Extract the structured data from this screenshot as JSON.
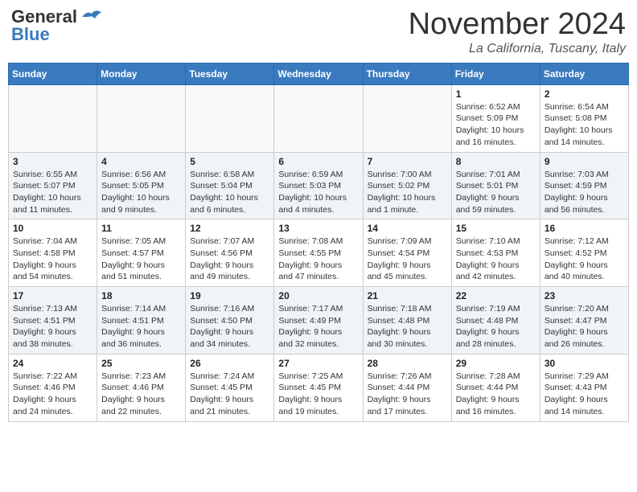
{
  "header": {
    "logo_general": "General",
    "logo_blue": "Blue",
    "month_year": "November 2024",
    "location": "La California, Tuscany, Italy"
  },
  "weekdays": [
    "Sunday",
    "Monday",
    "Tuesday",
    "Wednesday",
    "Thursday",
    "Friday",
    "Saturday"
  ],
  "weeks": [
    {
      "days": [
        {
          "num": "",
          "info": ""
        },
        {
          "num": "",
          "info": ""
        },
        {
          "num": "",
          "info": ""
        },
        {
          "num": "",
          "info": ""
        },
        {
          "num": "",
          "info": ""
        },
        {
          "num": "1",
          "info": "Sunrise: 6:52 AM\nSunset: 5:09 PM\nDaylight: 10 hours\nand 16 minutes."
        },
        {
          "num": "2",
          "info": "Sunrise: 6:54 AM\nSunset: 5:08 PM\nDaylight: 10 hours\nand 14 minutes."
        }
      ]
    },
    {
      "days": [
        {
          "num": "3",
          "info": "Sunrise: 6:55 AM\nSunset: 5:07 PM\nDaylight: 10 hours\nand 11 minutes."
        },
        {
          "num": "4",
          "info": "Sunrise: 6:56 AM\nSunset: 5:05 PM\nDaylight: 10 hours\nand 9 minutes."
        },
        {
          "num": "5",
          "info": "Sunrise: 6:58 AM\nSunset: 5:04 PM\nDaylight: 10 hours\nand 6 minutes."
        },
        {
          "num": "6",
          "info": "Sunrise: 6:59 AM\nSunset: 5:03 PM\nDaylight: 10 hours\nand 4 minutes."
        },
        {
          "num": "7",
          "info": "Sunrise: 7:00 AM\nSunset: 5:02 PM\nDaylight: 10 hours\nand 1 minute."
        },
        {
          "num": "8",
          "info": "Sunrise: 7:01 AM\nSunset: 5:01 PM\nDaylight: 9 hours\nand 59 minutes."
        },
        {
          "num": "9",
          "info": "Sunrise: 7:03 AM\nSunset: 4:59 PM\nDaylight: 9 hours\nand 56 minutes."
        }
      ]
    },
    {
      "days": [
        {
          "num": "10",
          "info": "Sunrise: 7:04 AM\nSunset: 4:58 PM\nDaylight: 9 hours\nand 54 minutes."
        },
        {
          "num": "11",
          "info": "Sunrise: 7:05 AM\nSunset: 4:57 PM\nDaylight: 9 hours\nand 51 minutes."
        },
        {
          "num": "12",
          "info": "Sunrise: 7:07 AM\nSunset: 4:56 PM\nDaylight: 9 hours\nand 49 minutes."
        },
        {
          "num": "13",
          "info": "Sunrise: 7:08 AM\nSunset: 4:55 PM\nDaylight: 9 hours\nand 47 minutes."
        },
        {
          "num": "14",
          "info": "Sunrise: 7:09 AM\nSunset: 4:54 PM\nDaylight: 9 hours\nand 45 minutes."
        },
        {
          "num": "15",
          "info": "Sunrise: 7:10 AM\nSunset: 4:53 PM\nDaylight: 9 hours\nand 42 minutes."
        },
        {
          "num": "16",
          "info": "Sunrise: 7:12 AM\nSunset: 4:52 PM\nDaylight: 9 hours\nand 40 minutes."
        }
      ]
    },
    {
      "days": [
        {
          "num": "17",
          "info": "Sunrise: 7:13 AM\nSunset: 4:51 PM\nDaylight: 9 hours\nand 38 minutes."
        },
        {
          "num": "18",
          "info": "Sunrise: 7:14 AM\nSunset: 4:51 PM\nDaylight: 9 hours\nand 36 minutes."
        },
        {
          "num": "19",
          "info": "Sunrise: 7:16 AM\nSunset: 4:50 PM\nDaylight: 9 hours\nand 34 minutes."
        },
        {
          "num": "20",
          "info": "Sunrise: 7:17 AM\nSunset: 4:49 PM\nDaylight: 9 hours\nand 32 minutes."
        },
        {
          "num": "21",
          "info": "Sunrise: 7:18 AM\nSunset: 4:48 PM\nDaylight: 9 hours\nand 30 minutes."
        },
        {
          "num": "22",
          "info": "Sunrise: 7:19 AM\nSunset: 4:48 PM\nDaylight: 9 hours\nand 28 minutes."
        },
        {
          "num": "23",
          "info": "Sunrise: 7:20 AM\nSunset: 4:47 PM\nDaylight: 9 hours\nand 26 minutes."
        }
      ]
    },
    {
      "days": [
        {
          "num": "24",
          "info": "Sunrise: 7:22 AM\nSunset: 4:46 PM\nDaylight: 9 hours\nand 24 minutes."
        },
        {
          "num": "25",
          "info": "Sunrise: 7:23 AM\nSunset: 4:46 PM\nDaylight: 9 hours\nand 22 minutes."
        },
        {
          "num": "26",
          "info": "Sunrise: 7:24 AM\nSunset: 4:45 PM\nDaylight: 9 hours\nand 21 minutes."
        },
        {
          "num": "27",
          "info": "Sunrise: 7:25 AM\nSunset: 4:45 PM\nDaylight: 9 hours\nand 19 minutes."
        },
        {
          "num": "28",
          "info": "Sunrise: 7:26 AM\nSunset: 4:44 PM\nDaylight: 9 hours\nand 17 minutes."
        },
        {
          "num": "29",
          "info": "Sunrise: 7:28 AM\nSunset: 4:44 PM\nDaylight: 9 hours\nand 16 minutes."
        },
        {
          "num": "30",
          "info": "Sunrise: 7:29 AM\nSunset: 4:43 PM\nDaylight: 9 hours\nand 14 minutes."
        }
      ]
    }
  ]
}
